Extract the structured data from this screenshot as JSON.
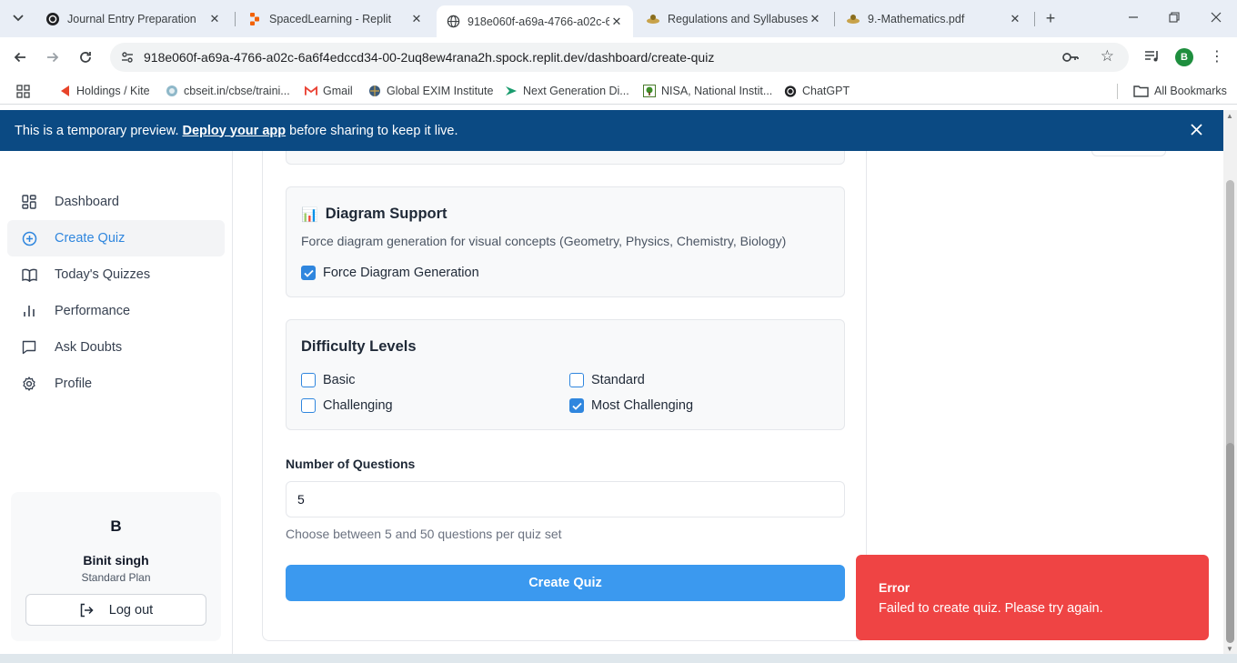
{
  "browser": {
    "tabs": [
      {
        "title": "Journal Entry Preparation",
        "active": false
      },
      {
        "title": "SpacedLearning - Replit",
        "active": false
      },
      {
        "title": "918e060f-a69a-4766-a02c-6",
        "active": true
      },
      {
        "title": "Regulations and Syllabuses -",
        "active": false
      },
      {
        "title": "9.-Mathematics.pdf",
        "active": false
      }
    ],
    "url": "918e060f-a69a-4766-a02c-6a6f4edccd34-00-2uq8ew4rana2h.spock.replit.dev/dashboard/create-quiz",
    "profile_initial": "B",
    "bookmarks": [
      {
        "label": "Holdings / Kite",
        "icon": "kite-icon"
      },
      {
        "label": "cbseit.in/cbse/traini...",
        "icon": "cbse-icon"
      },
      {
        "label": "Gmail",
        "icon": "gmail-icon"
      },
      {
        "label": "Global EXIM Institute",
        "icon": "globe-icon"
      },
      {
        "label": "Next Generation Di...",
        "icon": "arrow-icon"
      },
      {
        "label": "NISA, National Instit...",
        "icon": "tree-icon"
      },
      {
        "label": "ChatGPT",
        "icon": "openai-icon"
      }
    ],
    "all_bookmarks": "All Bookmarks"
  },
  "banner": {
    "prefix": "This is a temporary preview.",
    "link": "Deploy your app",
    "suffix": "before sharing to keep it live."
  },
  "sidebar": {
    "items": [
      {
        "label": "Dashboard",
        "icon": "dashboard-icon",
        "active": false
      },
      {
        "label": "Create Quiz",
        "icon": "plus-circle-icon",
        "active": true
      },
      {
        "label": "Today's Quizzes",
        "icon": "book-icon",
        "active": false
      },
      {
        "label": "Performance",
        "icon": "bar-chart-icon",
        "active": false
      },
      {
        "label": "Ask Doubts",
        "icon": "message-icon",
        "active": false
      },
      {
        "label": "Profile",
        "icon": "gear-icon",
        "active": false
      }
    ],
    "user": {
      "initial": "B",
      "name": "Binit singh",
      "plan": "Standard Plan",
      "logout_label": "Log out"
    }
  },
  "form": {
    "diagram": {
      "emoji": "📊",
      "title": "Diagram Support",
      "description": "Force diagram generation for visual concepts (Geometry, Physics, Chemistry, Biology)",
      "checkbox_label": "Force Diagram Generation",
      "checked": true
    },
    "difficulty": {
      "title": "Difficulty Levels",
      "options": [
        {
          "label": "Basic",
          "checked": false
        },
        {
          "label": "Standard",
          "checked": false
        },
        {
          "label": "Challenging",
          "checked": false
        },
        {
          "label": "Most Challenging",
          "checked": true
        }
      ]
    },
    "questions": {
      "label": "Number of Questions",
      "value": "5",
      "help": "Choose between 5 and 50 questions per quiz set"
    },
    "submit_label": "Create Quiz"
  },
  "toast": {
    "title": "Error",
    "message": "Failed to create quiz. Please try again."
  },
  "colors": {
    "accent": "#2f86de",
    "button": "#3b99ef",
    "banner": "#0b4a83",
    "error": "#ef4444"
  }
}
